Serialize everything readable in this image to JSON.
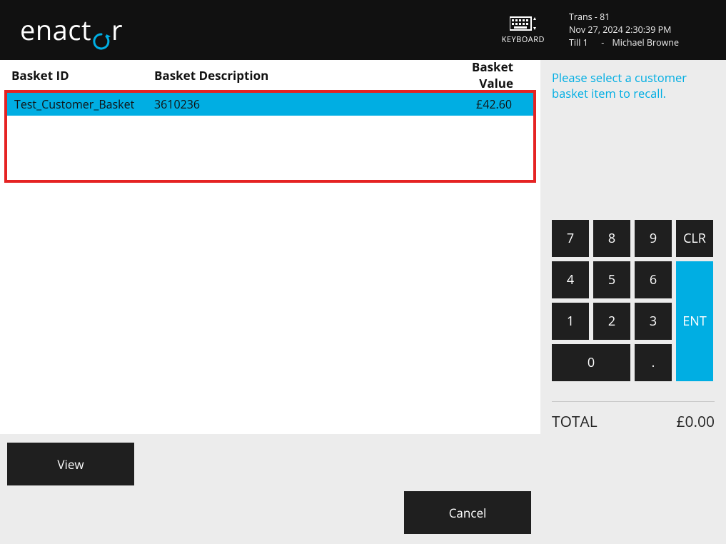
{
  "logo": {
    "pre": "enact",
    "post": "r"
  },
  "header": {
    "keyboard_label": "KEYBOARD",
    "trans_label": "Trans - 81",
    "datetime": "Nov 27, 2024 2:30:39 PM",
    "till_label": "Till 1",
    "dash": "-",
    "user_name": "Michael Browne"
  },
  "basket": {
    "headers": {
      "id": "Basket ID",
      "desc": "Basket Description",
      "value": "Basket Value"
    },
    "rows": [
      {
        "id": "Test_Customer_Basket",
        "desc": "3610236",
        "value": "£42.60"
      }
    ]
  },
  "buttons": {
    "view": "View",
    "cancel": "Cancel"
  },
  "right": {
    "prompt": "Please select a customer basket item to recall.",
    "keys": {
      "k7": "7",
      "k8": "8",
      "k9": "9",
      "clr": "CLR",
      "k4": "4",
      "k5": "5",
      "k6": "6",
      "k1": "1",
      "k2": "2",
      "k3": "3",
      "k0": "0",
      "dot": ".",
      "ent": "ENT"
    },
    "total_label": "TOTAL",
    "total_value": "£0.00"
  }
}
